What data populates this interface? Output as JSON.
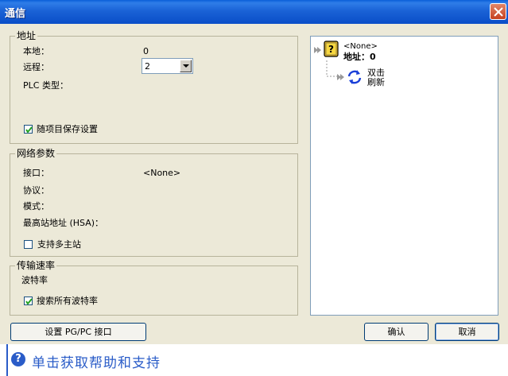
{
  "window": {
    "title": "通信"
  },
  "address": {
    "legend": "地址",
    "local_label": "本地：",
    "local_value": "0",
    "remote_label": "远程：",
    "remote_value": "2",
    "plc_type_label": "PLC 类型：",
    "save_with_project_label": "随项目保存设置",
    "save_with_project_checked": true
  },
  "network": {
    "legend": "网络参数",
    "interface_label": "接口：",
    "interface_value": "<None>",
    "protocol_label": "协议：",
    "mode_label": "模式：",
    "hsa_label": "最高站地址 (HSA)：",
    "multi_master_label": "支持多主站",
    "multi_master_checked": false
  },
  "transmission": {
    "legend": "传输速率",
    "baud_label": "波特率",
    "search_all_label": "搜索所有波特率",
    "search_all_checked": true
  },
  "tree": {
    "device_name": "<None>",
    "device_address": "地址：0",
    "refresh_line1": "双击",
    "refresh_line2": "刷新"
  },
  "buttons": {
    "set_pgpc": "设置 PG/PC 接口",
    "ok": "确认",
    "cancel": "取消"
  },
  "help": {
    "text": "单击获取帮助和支持"
  },
  "colors": {
    "titlebar": "#0a4ec8",
    "help_link": "#2a5cc8",
    "dialog_bg": "#ece9d8"
  }
}
